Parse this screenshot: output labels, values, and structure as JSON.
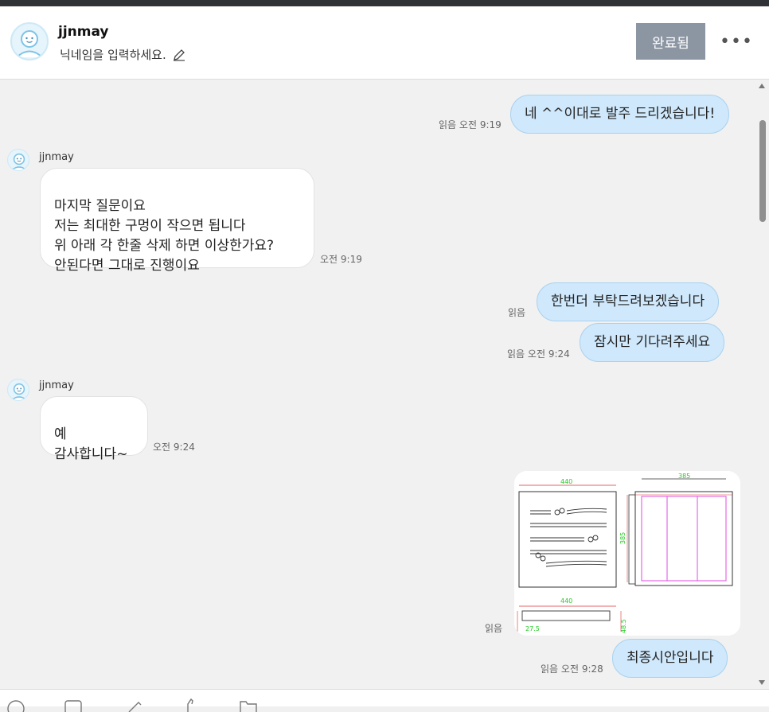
{
  "header": {
    "name": "jjnmay",
    "nickname_placeholder": "닉네임을 입력하세요.",
    "done_label": "완료됨",
    "more_label": "•••"
  },
  "messages": [
    {
      "side": "mine",
      "text": "네 ^^이대로 발주 드리겠습니다!",
      "read": "읽음",
      "time": "오전 9:19"
    },
    {
      "side": "theirs",
      "sender": "jjnmay",
      "text": "마지막 질문이요\n저는 최대한 구멍이 작으면 됩니다\n위 아래 각 한줄 삭제 하면 이상한가요?\n안된다면 그대로 진행이요",
      "time": "오전 9:19"
    },
    {
      "side": "mine",
      "text": "한번더 부탁드려보겠습니다",
      "read": "읽음",
      "time": ""
    },
    {
      "side": "mine",
      "text": "잠시만 기다려주세요",
      "read": "읽음",
      "time": "오전 9:24"
    },
    {
      "side": "theirs",
      "sender": "jjnmay",
      "text": "예\n감사합니다~",
      "time": "오전 9:24"
    },
    {
      "side": "mine",
      "type": "image",
      "read": "읽음",
      "time": "",
      "image_labels": {
        "top_width": "440",
        "right_width": "385",
        "side_height": "385",
        "bottom_width": "440",
        "bottom_left": "27.5",
        "bottom_right": "48.5"
      }
    },
    {
      "side": "mine",
      "text": "최종시안입니다",
      "read": "읽음",
      "time": "오전 9:28"
    }
  ],
  "colors": {
    "mine_bubble": "#cfe8fb",
    "theirs_bubble": "#ffffff",
    "done_button": "#8c96a3",
    "background": "#f1f1f1"
  },
  "icons": {
    "avatar": "avatar-icon",
    "edit": "pencil-icon",
    "more": "more-dots-icon"
  }
}
